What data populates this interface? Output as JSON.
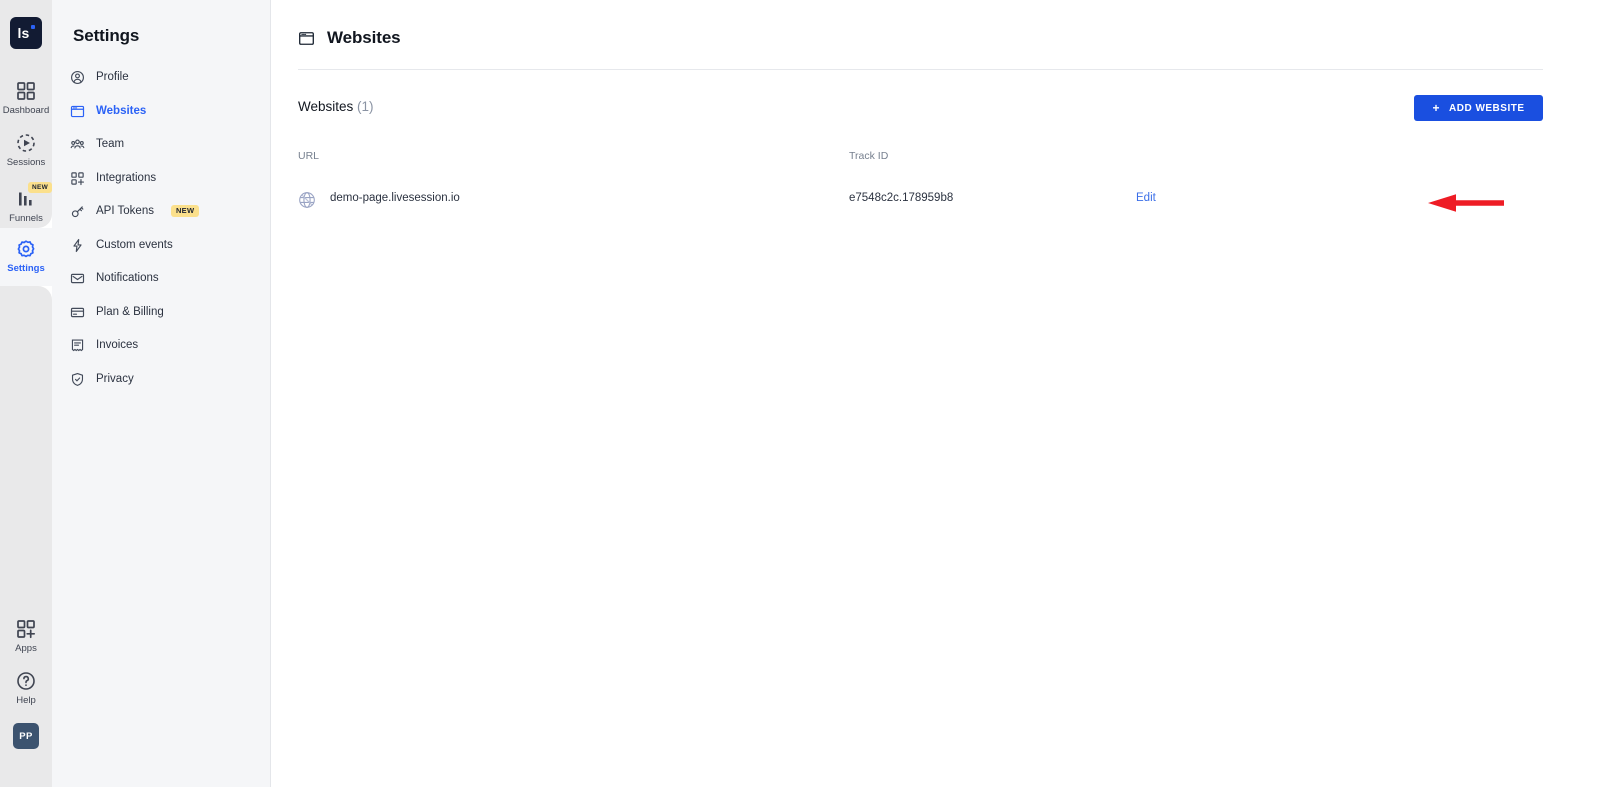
{
  "brand": {
    "logo_text": "ls",
    "accent_color": "#1a4fe0",
    "link_color": "#3b6fe8",
    "badge_color": "#fbe08c",
    "annotation_color": "#ee1c25"
  },
  "rail": {
    "items": [
      {
        "label": "Dashboard",
        "icon": "grid-icon",
        "active": false,
        "badge": ""
      },
      {
        "label": "Sessions",
        "icon": "play-circle-dashed-icon",
        "active": false,
        "badge": ""
      },
      {
        "label": "Funnels",
        "icon": "bar-chart-icon",
        "active": false,
        "badge": "NEW"
      },
      {
        "label": "Settings",
        "icon": "gear-icon",
        "active": true,
        "badge": ""
      }
    ],
    "bottom_items": [
      {
        "label": "Apps",
        "icon": "grid-plus-icon"
      },
      {
        "label": "Help",
        "icon": "question-circle-icon"
      }
    ],
    "avatar_initials": "PP"
  },
  "sidebar": {
    "title": "Settings",
    "items": [
      {
        "label": "Profile",
        "icon": "user-circle-icon",
        "active": false,
        "badge": ""
      },
      {
        "label": "Websites",
        "icon": "browser-window-icon",
        "active": true,
        "badge": ""
      },
      {
        "label": "Team",
        "icon": "people-icon",
        "active": false,
        "badge": ""
      },
      {
        "label": "Integrations",
        "icon": "grid-plus-icon",
        "active": false,
        "badge": ""
      },
      {
        "label": "API Tokens",
        "icon": "key-icon",
        "active": false,
        "badge": "NEW"
      },
      {
        "label": "Custom events",
        "icon": "lightning-bolt-icon",
        "active": false,
        "badge": ""
      },
      {
        "label": "Notifications",
        "icon": "envelope-icon",
        "active": false,
        "badge": ""
      },
      {
        "label": "Plan & Billing",
        "icon": "credit-card-icon",
        "active": false,
        "badge": ""
      },
      {
        "label": "Invoices",
        "icon": "invoice-icon",
        "active": false,
        "badge": ""
      },
      {
        "label": "Privacy",
        "icon": "shield-check-icon",
        "active": false,
        "badge": ""
      }
    ]
  },
  "main": {
    "page_title": "Websites",
    "page_icon": "browser-window-icon",
    "section_label": "Websites",
    "section_count": "(1)",
    "add_button_label": "ADD WEBSITE",
    "add_button_plus": "+",
    "columns": {
      "url": "URL",
      "track_id": "Track ID"
    },
    "rows": [
      {
        "url": "demo-page.livesession.io",
        "track_id": "e7548c2c.178959b8",
        "edit_label": "Edit",
        "favicon": "globe-icon"
      }
    ]
  },
  "annotation": {
    "type": "arrow-left",
    "target": "Edit"
  },
  "chat": {
    "widget": "intercom-chat-button"
  }
}
